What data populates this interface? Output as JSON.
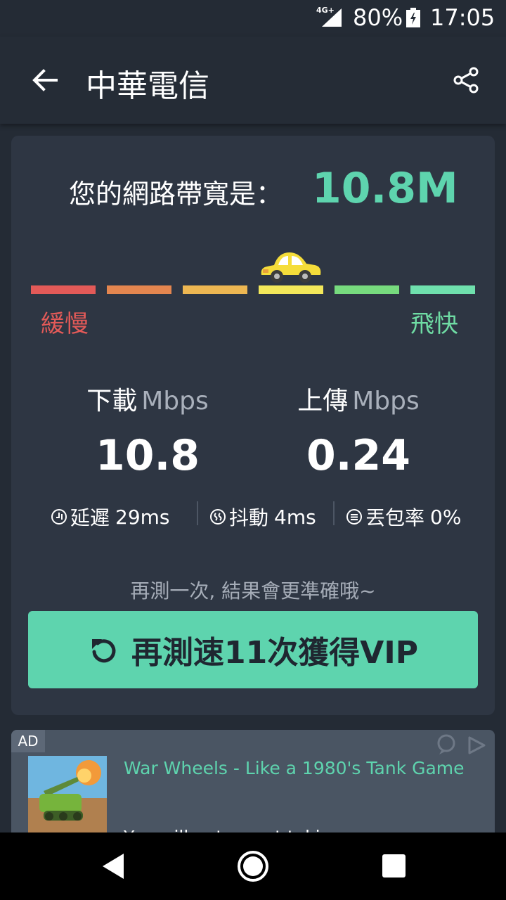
{
  "status_bar": {
    "network": "4G+",
    "battery": "80%",
    "time": "17:05",
    "icons": [
      "signal-icon",
      "battery-charging-icon"
    ]
  },
  "app_bar": {
    "title": "中華電信",
    "icons": [
      "back-arrow-icon",
      "share-icon"
    ]
  },
  "result": {
    "bandwidth_label": "您的網路帶寬是：",
    "bandwidth_value": "10.8M",
    "speed_meter": {
      "slow_label": "緩慢",
      "fast_label": "飛快",
      "segment_colors": [
        "#e35a58",
        "#e4864f",
        "#edb752",
        "#f3e85a",
        "#77db7e",
        "#6fe0ad"
      ],
      "active_segment": 4,
      "indicator_icon": "car-icon"
    },
    "download": {
      "label": "下載",
      "unit": "Mbps",
      "value": "10.8"
    },
    "upload": {
      "label": "上傳",
      "unit": "Mbps",
      "value": "0.24"
    },
    "metrics": [
      {
        "icon": "latency-icon",
        "label": "延遲",
        "value": "29ms"
      },
      {
        "icon": "jitter-icon",
        "label": "抖動",
        "value": "4ms"
      },
      {
        "icon": "packet-loss-icon",
        "label": "丟包率",
        "value": "0%"
      }
    ],
    "hint": "再測一次, 結果會更準確哦~",
    "retest_button": {
      "label": "再測速11次獲得VIP",
      "icon": "refresh-icon"
    }
  },
  "ad": {
    "badge": "AD",
    "title": "War Wheels - Like a 1980's Tank Game",
    "subtitle": "You will not regret taking",
    "icons": [
      "ad-chat-icon",
      "ad-play-icon"
    ]
  },
  "nav_bar": {
    "icons": [
      "nav-back-icon",
      "nav-home-icon",
      "nav-recents-icon"
    ]
  },
  "colors": {
    "accent": "#5ed4ae",
    "background": "#242b35",
    "card": "#2e3643",
    "slow": "#e35a58",
    "fast": "#6fdca4"
  }
}
